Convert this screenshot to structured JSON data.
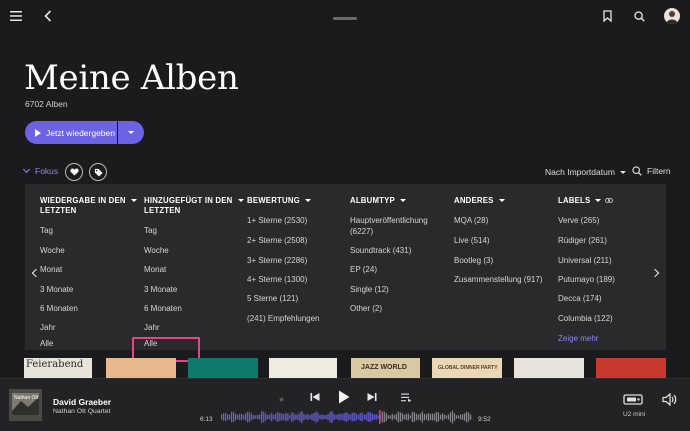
{
  "page": {
    "title": "Meine Alben",
    "album_count": "6702 Alben",
    "play_button": "Jetzt wiedergeben"
  },
  "toolbar": {
    "focus_label": "Fokus",
    "sort_label": "Nach Importdatum",
    "filter_label": "Filtern"
  },
  "filters": {
    "columns": [
      {
        "header_l1": "WIEDERGABE IN DEN",
        "header_l2": "LETZTEN",
        "options": [
          "Tag",
          "Woche",
          "Monat",
          "3 Monate",
          "6 Monaten",
          "Jahr",
          "Alle"
        ]
      },
      {
        "header_l1": "HINZUGEFÜGT IN DEN",
        "header_l2": "LETZTEN",
        "options": [
          "Tag",
          "Woche",
          "Monat",
          "3 Monate",
          "6 Monaten",
          "Jahr",
          "Alle"
        ]
      },
      {
        "header_l1": "BEWERTUNG",
        "header_l2": "",
        "options": [
          "1+ Sterne (2530)",
          "2+ Sterne (2508)",
          "3+ Sterne (2286)",
          "4+ Sterne (1300)",
          "5 Sterne (121)",
          "(241) Empfehlungen"
        ]
      },
      {
        "header_l1": "ALBUMTYP",
        "header_l2": "",
        "options": [
          "Hauptveröffentlichung",
          "(6227)",
          "Soundtrack (431)",
          "EP (24)",
          "Single (12)",
          "Other (2)"
        ]
      },
      {
        "header_l1": "ANDERES",
        "header_l2": "",
        "options": [
          "MQA (28)",
          "Live (514)",
          "Bootleg (3)",
          "Zusammenstellung (917)"
        ]
      },
      {
        "header_l1": "LABELS",
        "header_l2": "",
        "options": [
          "Verve (265)",
          "Rüdiger (261)",
          "Universal (211)",
          "Putumayo (189)",
          "Decca (174)",
          "Columbia (122)"
        ],
        "more": "Zeige mehr"
      }
    ]
  },
  "tiles": [
    {
      "text": "Feierabend",
      "color": "#e9e4d8"
    },
    {
      "text": "",
      "color": "#e7b98a"
    },
    {
      "text": "",
      "color": "#0f7a6a"
    },
    {
      "text": "",
      "color": "#f0ebe0"
    },
    {
      "text": "JAZZ WORLD",
      "color": "#d9c9a3"
    },
    {
      "text": "GLOBAL DINNER PARTY",
      "color": "#e9d7b8"
    },
    {
      "text": "",
      "color": "#e8e4dc"
    },
    {
      "text": "",
      "color": "#c93a2e"
    }
  ],
  "player": {
    "track": "David Graeber",
    "artist": "Nathan Ott Quartet",
    "elapsed": "6:13",
    "total": "9:52",
    "progress": 0.63,
    "device": "U2 mini",
    "album_art_text": "Nathan Ott"
  },
  "colors": {
    "accent": "#6b63e3",
    "accent_text": "#8e88f0",
    "highlight": "#e8428c"
  }
}
